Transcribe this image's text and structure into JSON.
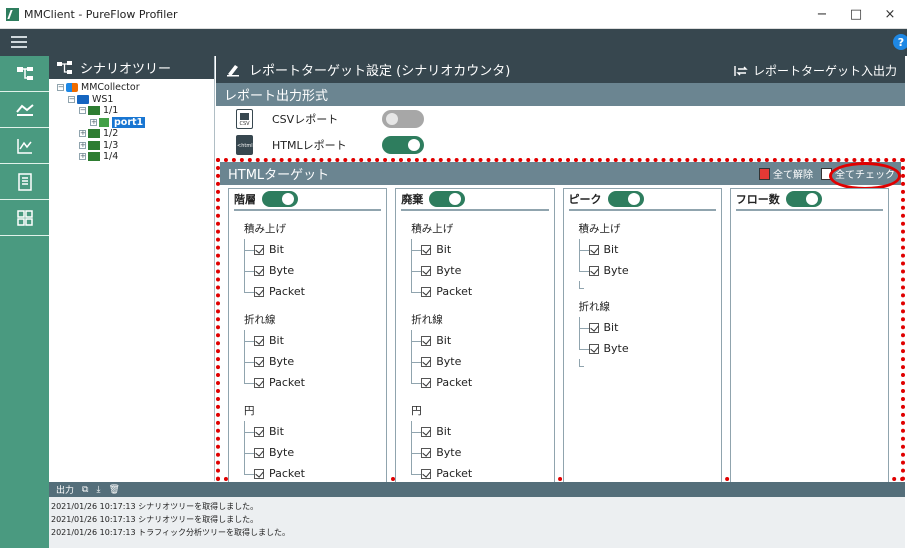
{
  "window": {
    "title": "MMClient - PureFlow Profiler",
    "minimize": "−",
    "maximize": "□",
    "close": "×"
  },
  "topbar": {
    "help": "?"
  },
  "tree_panel": {
    "title": "シナリオツリー",
    "nodes": [
      {
        "label": "MMCollector"
      },
      {
        "label": "WS1"
      },
      {
        "label": "1/1"
      },
      {
        "label": "port1"
      },
      {
        "label": "1/2"
      },
      {
        "label": "1/3"
      },
      {
        "label": "1/4"
      }
    ]
  },
  "main": {
    "title": "レポートターゲット設定 (シナリオカウンタ)",
    "io_label": "レポートターゲット入出力",
    "report_format": {
      "title": "レポート出力形式",
      "csv": {
        "label": "CSVレポート",
        "icon_text": "CSV",
        "enabled": false
      },
      "html": {
        "label": "HTMLレポート",
        "icon_text": "<html>",
        "enabled": true
      }
    },
    "html_target": {
      "title": "HTMLターゲット",
      "uncheck_all": "全て解除",
      "check_all": "全てチェック",
      "columns": [
        {
          "title": "階層",
          "enabled": true,
          "groups": [
            {
              "title": "積み上げ",
              "items": [
                "Bit",
                "Byte",
                "Packet"
              ]
            },
            {
              "title": "折れ線",
              "items": [
                "Bit",
                "Byte",
                "Packet"
              ]
            },
            {
              "title": "円",
              "items": [
                "Bit",
                "Byte",
                "Packet"
              ]
            }
          ]
        },
        {
          "title": "廃棄",
          "enabled": true,
          "groups": [
            {
              "title": "積み上げ",
              "items": [
                "Bit",
                "Byte",
                "Packet"
              ]
            },
            {
              "title": "折れ線",
              "items": [
                "Bit",
                "Byte",
                "Packet"
              ]
            },
            {
              "title": "円",
              "items": [
                "Bit",
                "Byte",
                "Packet"
              ]
            }
          ]
        },
        {
          "title": "ピーク",
          "enabled": true,
          "groups": [
            {
              "title": "積み上げ",
              "items": [
                "Bit",
                "Byte"
              ]
            },
            {
              "title": "折れ線",
              "items": [
                "Bit",
                "Byte"
              ]
            }
          ]
        },
        {
          "title": "フロー数",
          "enabled": true,
          "groups": []
        }
      ]
    }
  },
  "output": {
    "title": "出力",
    "lines": [
      "2021/01/26 10:17:13 シナリオツリーを取得しました。",
      "2021/01/26 10:17:13 シナリオツリーを取得しました。",
      "2021/01/26 10:17:13 トラフィック分析ツリーを取得しました。"
    ]
  }
}
